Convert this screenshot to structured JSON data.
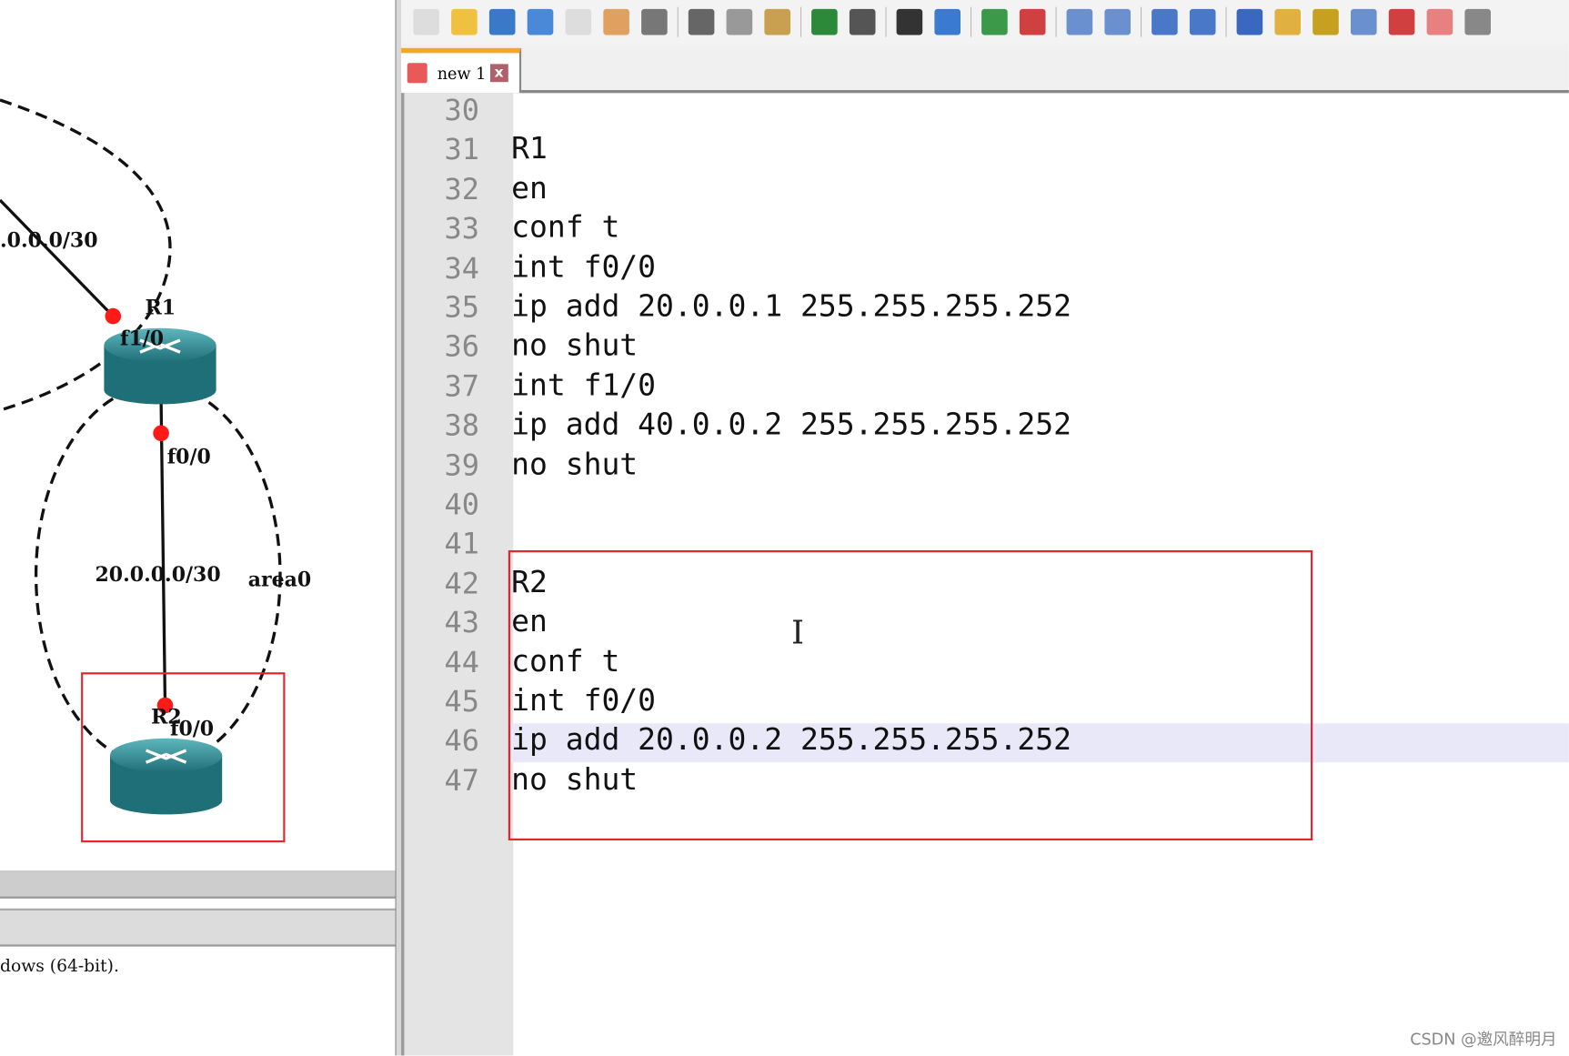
{
  "topology": {
    "labels": [
      ".0.0.0/30",
      "R1",
      "f1/0",
      "f0/0",
      "20.0.0.0/30",
      "area0",
      "R2",
      "f0/0"
    ],
    "colors": {
      "router": "#2b8a94",
      "link_dot": "#ff1a1a",
      "highlight_box": "#e8252e"
    }
  },
  "console": {
    "text": "dows (64-bit)."
  },
  "toolbar": {
    "icons": [
      "new-file-icon",
      "open-file-icon",
      "save-icon",
      "save-all-icon",
      "close-icon",
      "close-all-icon",
      "print-icon",
      "cut-icon",
      "copy-icon",
      "paste-icon",
      "undo-icon",
      "redo-icon",
      "find-icon",
      "replace-icon",
      "zoom-in-icon",
      "zoom-out-icon",
      "sync-vertical-icon",
      "sync-horizontal-icon",
      "word-wrap-icon",
      "show-all-characters-icon",
      "indent-guide-icon",
      "user-language-icon",
      "document-map-icon",
      "function-list-icon",
      "folder-workspace-icon",
      "monitoring-icon",
      "macro-record-icon"
    ]
  },
  "tab": {
    "name": "new 1",
    "close": "x"
  },
  "editor": {
    "lines": [
      {
        "n": "30",
        "text": ""
      },
      {
        "n": "31",
        "text": "R1"
      },
      {
        "n": "32",
        "text": "en"
      },
      {
        "n": "33",
        "text": "conf t"
      },
      {
        "n": "34",
        "text": "int f0/0"
      },
      {
        "n": "35",
        "text": "ip add 20.0.0.1 255.255.255.252"
      },
      {
        "n": "36",
        "text": "no shut"
      },
      {
        "n": "37",
        "text": "int f1/0"
      },
      {
        "n": "38",
        "text": "ip add 40.0.0.2 255.255.255.252"
      },
      {
        "n": "39",
        "text": "no shut"
      },
      {
        "n": "40",
        "text": ""
      },
      {
        "n": "41",
        "text": ""
      },
      {
        "n": "42",
        "text": "R2"
      },
      {
        "n": "43",
        "text": "en"
      },
      {
        "n": "44",
        "text": "conf t"
      },
      {
        "n": "45",
        "text": "int f0/0"
      },
      {
        "n": "46",
        "text": "ip add 20.0.0.2 255.255.255.252"
      },
      {
        "n": "47",
        "text": "no shut"
      }
    ],
    "current_line": "46"
  },
  "watermark": "CSDN @邀风醉明月"
}
